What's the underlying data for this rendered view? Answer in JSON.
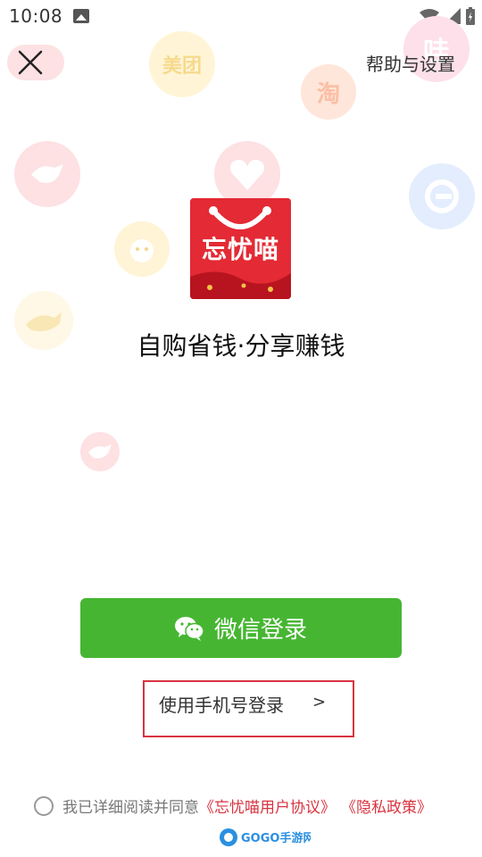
{
  "status_bar": {
    "time": "10:08"
  },
  "header": {
    "help_label": "帮助与设置"
  },
  "bubbles": {
    "meituan": "美团",
    "taobao": "淘",
    "ali": "哇"
  },
  "logo": {
    "text": "忘忧喵"
  },
  "tagline": "自购省钱·分享赚钱",
  "wechat_login": {
    "label": "微信登录"
  },
  "phone_login": {
    "label": "使用手机号登录",
    "arrow": ">"
  },
  "agreement": {
    "prefix": "我已详细阅读并同意",
    "user_agreement": "《忘忧喵用户协议》",
    "privacy_policy": "《隐私政策》"
  },
  "watermark": {
    "text": "GOGO手游网"
  },
  "colors": {
    "brand_red": "#e32a35",
    "wechat_green": "#46b632",
    "link_red": "#d9333f",
    "highlight_border": "#d9333f"
  }
}
